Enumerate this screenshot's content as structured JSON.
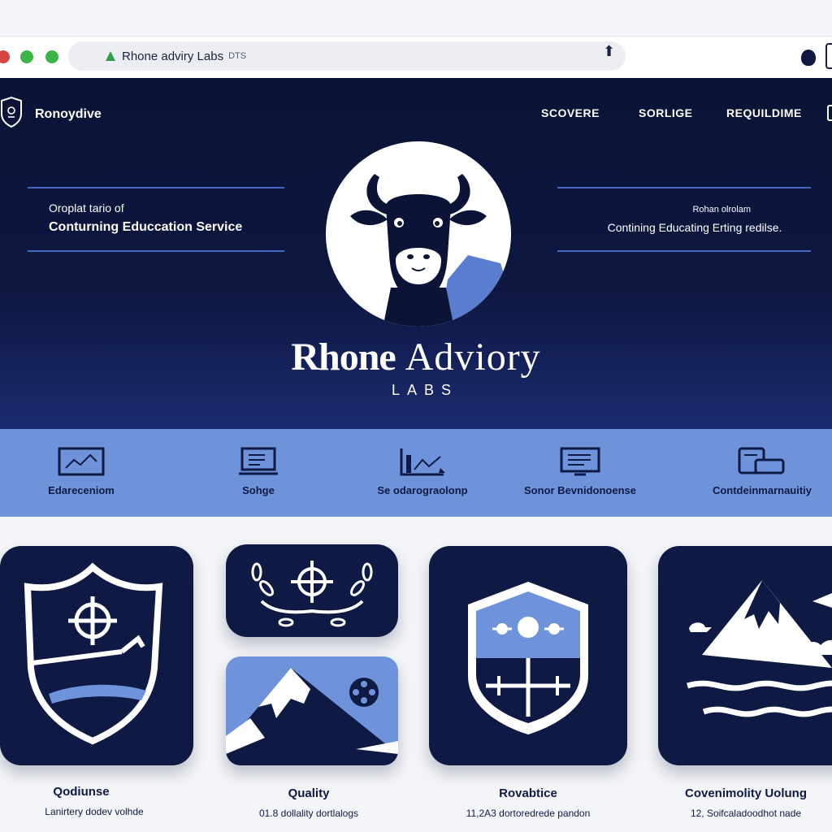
{
  "browser": {
    "url_text": "Rhone adviry Labs",
    "url_suffix": "DTS"
  },
  "header": {
    "brand": "Ronoydive",
    "nav": [
      "SCOVERE",
      "SORLIGE",
      "REQUILDIME"
    ]
  },
  "hero": {
    "left_tagline_1": "Oroplat tario of",
    "left_tagline_2": "Conturning Educcation Service",
    "right_tagline_1": "Rohan olrolam",
    "right_tagline_2": "Contining Educating Erting redilse.",
    "title_bold": "Rhone",
    "title_light": "Adviory",
    "subtitle": "LABS"
  },
  "features": [
    {
      "label": "Edareceniom",
      "icon": "chart-monitor-icon"
    },
    {
      "label": "Sohge",
      "icon": "laptop-icon"
    },
    {
      "label": "Se odarograolonp",
      "icon": "analytics-icon"
    },
    {
      "label": "Sonor Bevnidonoense",
      "icon": "document-monitor-icon"
    },
    {
      "label": "Contdeinmarnauitiy",
      "icon": "cards-icon"
    }
  ],
  "cards": [
    {
      "title": "Qodiunse",
      "subtitle": "Lanirtery dodev volhde"
    },
    {
      "title": "Quality",
      "subtitle": "01.8 dollality dortlalogs"
    },
    {
      "title": "Rovabtice",
      "subtitle": "11,2A3 dortoredrede pandon"
    },
    {
      "title": "Covenimolity Uolung",
      "subtitle": "12, Soifcaladoodhot nade"
    }
  ],
  "colors": {
    "navy": "#0f1a44",
    "hero_dark": "#0b1336",
    "accent_blue": "#6f93db",
    "rule_blue": "#4a68c4"
  }
}
